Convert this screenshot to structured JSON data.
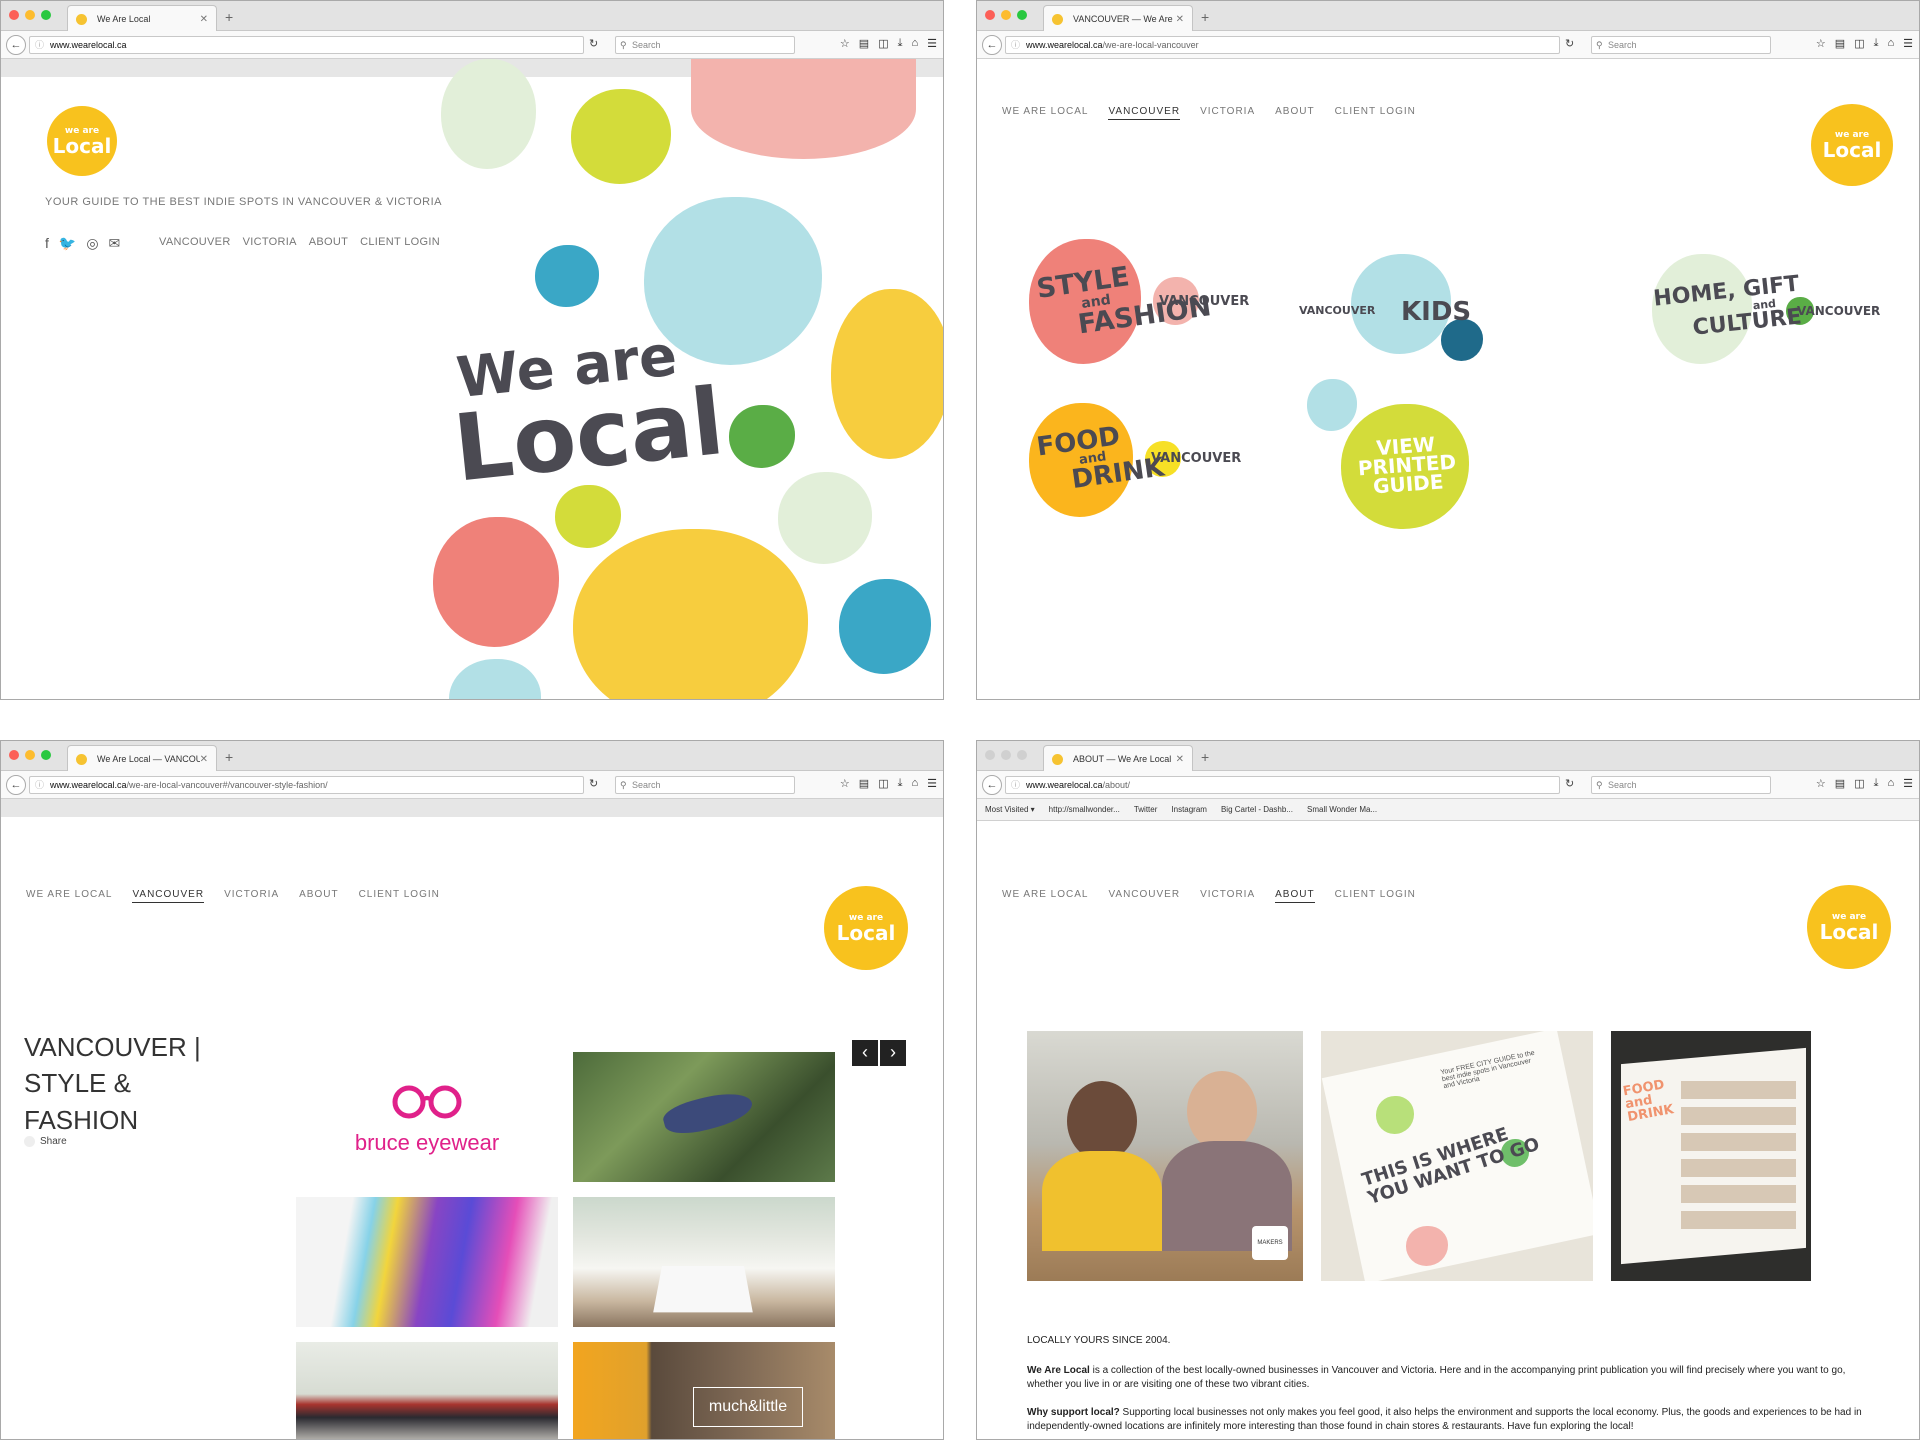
{
  "windows": [
    {
      "tab_title": "We Are Local",
      "url_domain": "www.wearelocal.ca",
      "url_path": ""
    },
    {
      "tab_title": "VANCOUVER — We Are Local",
      "url_domain": "www.wearelocal.ca",
      "url_path": "/we-are-local-vancouver"
    },
    {
      "tab_title": "We Are Local — VANCOUV...",
      "url_domain": "www.wearelocal.ca",
      "url_path": "/we-are-local-vancouver#/vancouver-style-fashion/"
    },
    {
      "tab_title": "ABOUT — We Are Local",
      "url_domain": "www.wearelocal.ca",
      "url_path": "/about/"
    }
  ],
  "browser": {
    "search_placeholder": "Search",
    "new_tab": "+",
    "close": "✕"
  },
  "bookmarks": [
    "Most Visited ▾",
    "http://smallwonder...",
    "Twitter",
    "Instagram",
    "Big Cartel - Dashb...",
    "Small Wonder Ma..."
  ],
  "logo": {
    "small": "we are",
    "big": "Local"
  },
  "home": {
    "tagline": "YOUR GUIDE TO THE BEST INDIE SPOTS IN VANCOUVER & VICTORIA",
    "nav": [
      "VANCOUVER",
      "VICTORIA",
      "ABOUT",
      "CLIENT LOGIN"
    ],
    "hero_line1": "We are",
    "hero_line2": "Local"
  },
  "site_nav": [
    "WE ARE LOCAL",
    "VANCOUVER",
    "VICTORIA",
    "ABOUT",
    "CLIENT LOGIN"
  ],
  "vancouver": {
    "categories": [
      {
        "l1": "STYLE",
        "l2": "and",
        "l3": "FASHION",
        "tag": "VANCOUVER"
      },
      {
        "l1": "KIDS",
        "tag": "VANCOUVER"
      },
      {
        "l1": "HOME, GIFT",
        "l2": "and",
        "l3": "CULTURE",
        "tag": "VANCOUVER"
      },
      {
        "l1": "FOOD",
        "l2": "and",
        "l3": "DRINK",
        "tag": "VANCOUVER"
      },
      {
        "l1": "VIEW",
        "l2": "PRINTED",
        "l3": "GUIDE"
      }
    ]
  },
  "style_fashion": {
    "heading": [
      "VANCOUVER |",
      "STYLE &",
      "FASHION"
    ],
    "share": "Share",
    "brand1": "bruce eyewear",
    "brand2": "much&little",
    "prev": "‹",
    "next": "›"
  },
  "about": {
    "since": "LOCALLY YOURS SINCE 2004.",
    "p1_bold": "We Are Local",
    "p1": " is a collection of the best locally-owned businesses in Vancouver and Victoria. Here and in the accompanying print publication you will find precisely where you want to go, whether you live in or are visiting one of these two vibrant cities.",
    "p2_bold": "Why support local?",
    "p2": " Supporting local businesses not only makes you feel good, it also helps the environment and supports the local economy. Plus, the goods and experiences to be had in independently-owned locations are infinitely more interesting than those found in chain stores & restaurants. Have fun exploring the local!",
    "guide_text": "THIS IS WHERE YOU WANT TO GO",
    "guide_small": "Your FREE CITY GUIDE to the best indie spots in Vancouver and Victoria",
    "mag_text": "FOOD and DRINK",
    "mug": "MAKERS"
  }
}
